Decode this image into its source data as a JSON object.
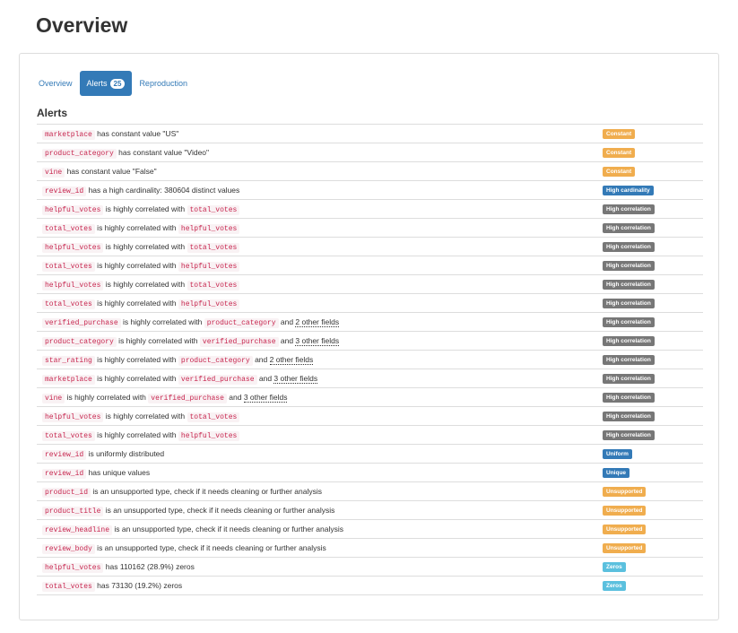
{
  "page": {
    "title": "Overview"
  },
  "tabs": [
    {
      "label": "Overview",
      "active": false
    },
    {
      "label": "Alerts",
      "count": "25",
      "active": true
    },
    {
      "label": "Reproduction",
      "active": false
    }
  ],
  "section": {
    "title": "Alerts"
  },
  "colors": {
    "accent": "#337ab7",
    "constant": "#f0ad4e",
    "unsupported": "#f0ad4e",
    "high_cardinality": "#337ab7",
    "high_correlation": "#777777",
    "uniform": "#337ab7",
    "unique": "#337ab7",
    "zeros": "#5bc0de",
    "code_text": "#c7254e"
  },
  "alerts": [
    {
      "parts": [
        {
          "t": "code",
          "v": "marketplace"
        },
        {
          "t": "text",
          "v": " has constant value \"US\""
        }
      ],
      "badge": "Constant",
      "kind": "constant"
    },
    {
      "parts": [
        {
          "t": "code",
          "v": "product_category"
        },
        {
          "t": "text",
          "v": " has constant value \"Video\""
        }
      ],
      "badge": "Constant",
      "kind": "constant"
    },
    {
      "parts": [
        {
          "t": "code",
          "v": "vine"
        },
        {
          "t": "text",
          "v": " has constant value \"False\""
        }
      ],
      "badge": "Constant",
      "kind": "constant"
    },
    {
      "parts": [
        {
          "t": "code",
          "v": "review_id"
        },
        {
          "t": "text",
          "v": " has a high cardinality: 380604 distinct values"
        }
      ],
      "badge": "High cardinality",
      "kind": "high-cardinality"
    },
    {
      "parts": [
        {
          "t": "code",
          "v": "helpful_votes"
        },
        {
          "t": "text",
          "v": " is highly correlated with "
        },
        {
          "t": "code",
          "v": "total_votes"
        }
      ],
      "badge": "High correlation",
      "kind": "high-correlation"
    },
    {
      "parts": [
        {
          "t": "code",
          "v": "total_votes"
        },
        {
          "t": "text",
          "v": " is highly correlated with "
        },
        {
          "t": "code",
          "v": "helpful_votes"
        }
      ],
      "badge": "High correlation",
      "kind": "high-correlation"
    },
    {
      "parts": [
        {
          "t": "code",
          "v": "helpful_votes"
        },
        {
          "t": "text",
          "v": " is highly correlated with "
        },
        {
          "t": "code",
          "v": "total_votes"
        }
      ],
      "badge": "High correlation",
      "kind": "high-correlation"
    },
    {
      "parts": [
        {
          "t": "code",
          "v": "total_votes"
        },
        {
          "t": "text",
          "v": " is highly correlated with "
        },
        {
          "t": "code",
          "v": "helpful_votes"
        }
      ],
      "badge": "High correlation",
      "kind": "high-correlation"
    },
    {
      "parts": [
        {
          "t": "code",
          "v": "helpful_votes"
        },
        {
          "t": "text",
          "v": " is highly correlated with "
        },
        {
          "t": "code",
          "v": "total_votes"
        }
      ],
      "badge": "High correlation",
      "kind": "high-correlation"
    },
    {
      "parts": [
        {
          "t": "code",
          "v": "total_votes"
        },
        {
          "t": "text",
          "v": " is highly correlated with "
        },
        {
          "t": "code",
          "v": "helpful_votes"
        }
      ],
      "badge": "High correlation",
      "kind": "high-correlation"
    },
    {
      "parts": [
        {
          "t": "code",
          "v": "verified_purchase"
        },
        {
          "t": "text",
          "v": " is highly correlated with "
        },
        {
          "t": "code",
          "v": "product_category"
        },
        {
          "t": "text",
          "v": " and "
        },
        {
          "t": "link",
          "v": "2 other fields"
        }
      ],
      "badge": "High correlation",
      "kind": "high-correlation"
    },
    {
      "parts": [
        {
          "t": "code",
          "v": "product_category"
        },
        {
          "t": "text",
          "v": " is highly correlated with "
        },
        {
          "t": "code",
          "v": "verified_purchase"
        },
        {
          "t": "text",
          "v": " and "
        },
        {
          "t": "link",
          "v": "3 other fields"
        }
      ],
      "badge": "High correlation",
      "kind": "high-correlation"
    },
    {
      "parts": [
        {
          "t": "code",
          "v": "star_rating"
        },
        {
          "t": "text",
          "v": " is highly correlated with "
        },
        {
          "t": "code",
          "v": "product_category"
        },
        {
          "t": "text",
          "v": " and "
        },
        {
          "t": "link",
          "v": "2 other fields"
        }
      ],
      "badge": "High correlation",
      "kind": "high-correlation"
    },
    {
      "parts": [
        {
          "t": "code",
          "v": "marketplace"
        },
        {
          "t": "text",
          "v": " is highly correlated with "
        },
        {
          "t": "code",
          "v": "verified_purchase"
        },
        {
          "t": "text",
          "v": " and "
        },
        {
          "t": "link",
          "v": "3 other fields"
        }
      ],
      "badge": "High correlation",
      "kind": "high-correlation"
    },
    {
      "parts": [
        {
          "t": "code",
          "v": "vine"
        },
        {
          "t": "text",
          "v": " is highly correlated with "
        },
        {
          "t": "code",
          "v": "verified_purchase"
        },
        {
          "t": "text",
          "v": " and "
        },
        {
          "t": "link",
          "v": "3 other fields"
        }
      ],
      "badge": "High correlation",
      "kind": "high-correlation"
    },
    {
      "parts": [
        {
          "t": "code",
          "v": "helpful_votes"
        },
        {
          "t": "text",
          "v": " is highly correlated with "
        },
        {
          "t": "code",
          "v": "total_votes"
        }
      ],
      "badge": "High correlation",
      "kind": "high-correlation"
    },
    {
      "parts": [
        {
          "t": "code",
          "v": "total_votes"
        },
        {
          "t": "text",
          "v": " is highly correlated with "
        },
        {
          "t": "code",
          "v": "helpful_votes"
        }
      ],
      "badge": "High correlation",
      "kind": "high-correlation"
    },
    {
      "parts": [
        {
          "t": "code",
          "v": "review_id"
        },
        {
          "t": "text",
          "v": " is uniformly distributed"
        }
      ],
      "badge": "Uniform",
      "kind": "uniform"
    },
    {
      "parts": [
        {
          "t": "code",
          "v": "review_id"
        },
        {
          "t": "text",
          "v": " has unique values"
        }
      ],
      "badge": "Unique",
      "kind": "unique"
    },
    {
      "parts": [
        {
          "t": "code",
          "v": "product_id"
        },
        {
          "t": "text",
          "v": " is an unsupported type, check if it needs cleaning or further analysis"
        }
      ],
      "badge": "Unsupported",
      "kind": "unsupported"
    },
    {
      "parts": [
        {
          "t": "code",
          "v": "product_title"
        },
        {
          "t": "text",
          "v": " is an unsupported type, check if it needs cleaning or further analysis"
        }
      ],
      "badge": "Unsupported",
      "kind": "unsupported"
    },
    {
      "parts": [
        {
          "t": "code",
          "v": "review_headline"
        },
        {
          "t": "text",
          "v": " is an unsupported type, check if it needs cleaning or further analysis"
        }
      ],
      "badge": "Unsupported",
      "kind": "unsupported"
    },
    {
      "parts": [
        {
          "t": "code",
          "v": "review_body"
        },
        {
          "t": "text",
          "v": " is an unsupported type, check if it needs cleaning or further analysis"
        }
      ],
      "badge": "Unsupported",
      "kind": "unsupported"
    },
    {
      "parts": [
        {
          "t": "code",
          "v": "helpful_votes"
        },
        {
          "t": "text",
          "v": " has 110162 (28.9%) zeros"
        }
      ],
      "badge": "Zeros",
      "kind": "zeros"
    },
    {
      "parts": [
        {
          "t": "code",
          "v": "total_votes"
        },
        {
          "t": "text",
          "v": " has 73130 (19.2%) zeros"
        }
      ],
      "badge": "Zeros",
      "kind": "zeros"
    }
  ]
}
